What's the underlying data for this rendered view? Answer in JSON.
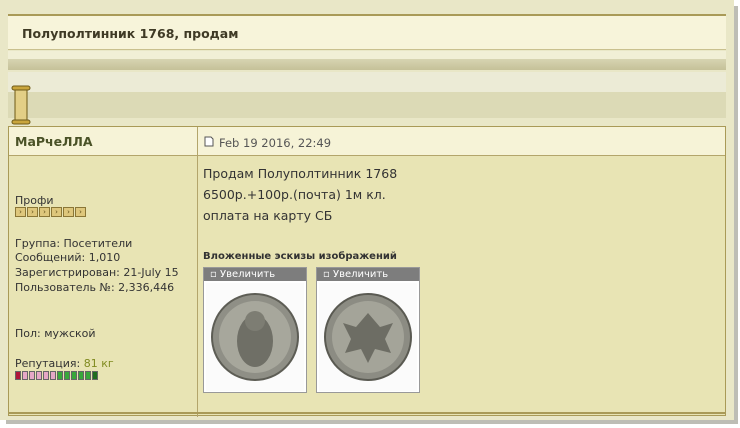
{
  "topic": {
    "title": "Полуполтинник 1768, продам"
  },
  "post": {
    "author": "МаРчеЛЛА",
    "date": "Feb 19 2016, 22:49",
    "user": {
      "rank": "Профи",
      "group": "Группа: Посетители",
      "messages": "Сообщений: 1,010",
      "registered": "Зарегистрирован: 21-July 15",
      "user_no": "Пользователь №: 2,336,446",
      "gender": "Пол: мужской",
      "reputation_label": "Репутация:",
      "reputation_value": "81 кг",
      "rank_pips": 6,
      "reputation_bar": {
        "negative_filled": 1,
        "negative_empty": 5,
        "positive_filled": 6
      }
    },
    "lines": [
      "Продам Полуполтинник 1768",
      "6500р.+100р.(почта) 1м кл.",
      "оплата на карту СБ"
    ],
    "attachments_title": "Вложенные эскизы изображений",
    "thumbnails": [
      {
        "label": "Увеличить",
        "alt": "coin obverse"
      },
      {
        "label": "Увеличить",
        "alt": "coin reverse"
      }
    ]
  },
  "colors": {
    "page_bg": "#e9e7c7",
    "header_bg": "#f7f4da",
    "border": "#a99a57",
    "rep_negative": "#b0163a",
    "rep_positive": "#1f8a1f"
  }
}
